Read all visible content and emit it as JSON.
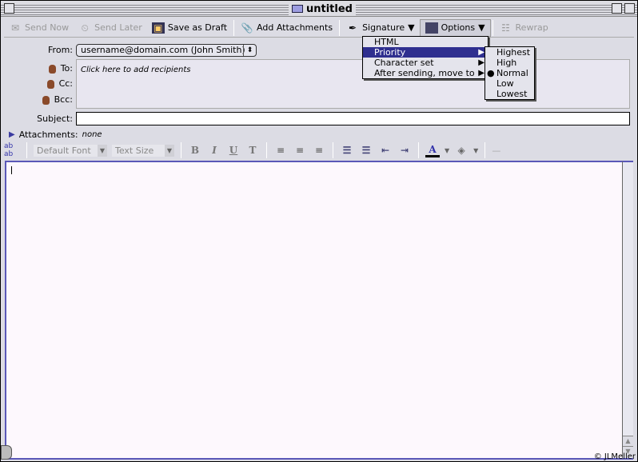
{
  "window": {
    "title": "untitled"
  },
  "toolbar": {
    "send_now": "Send Now",
    "send_later": "Send Later",
    "save_draft": "Save as Draft",
    "add_attachments": "Add Attachments",
    "signature": "Signature",
    "options": "Options",
    "rewrap": "Rewrap"
  },
  "header": {
    "from_label": "From:",
    "from_value": "username@domain.com (John Smith)",
    "to_label": "To:",
    "cc_label": "Cc:",
    "bcc_label": "Bcc:",
    "recipients_placeholder": "Click here to add recipients",
    "subject_label": "Subject:",
    "subject_value": "",
    "attachments_label": "Attachments:",
    "attachments_value": "none"
  },
  "format": {
    "font": "Default Font",
    "size": "Text Size"
  },
  "options_menu": {
    "items": [
      "HTML",
      "Priority",
      "Character set",
      "After sending, move to"
    ]
  },
  "priority_menu": {
    "items": [
      "Highest",
      "High",
      "Normal",
      "Low",
      "Lowest"
    ],
    "selected": "Normal"
  },
  "footer": {
    "copyright": "© JLMeller"
  },
  "colors": {
    "accent": "#2f2f8f",
    "body_border": "#5a58b8"
  }
}
